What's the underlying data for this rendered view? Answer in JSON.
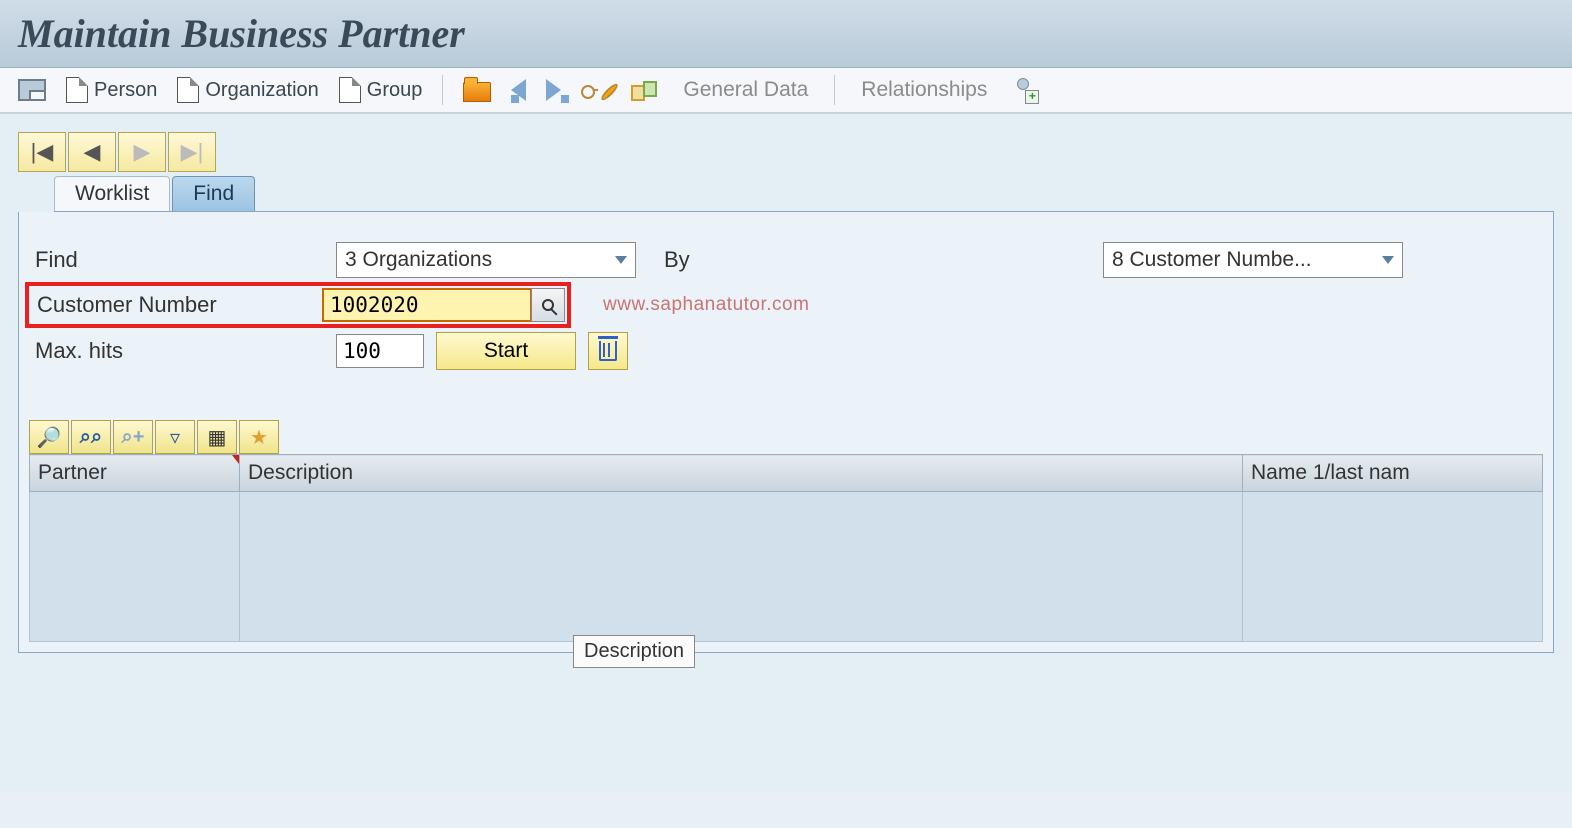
{
  "title": "Maintain Business Partner",
  "toolbar": {
    "person": "Person",
    "organization": "Organization",
    "group": "Group",
    "general_data": "General Data",
    "relationships": "Relationships"
  },
  "tabs": {
    "worklist": "Worklist",
    "find": "Find"
  },
  "find_form": {
    "find_label": "Find",
    "find_value": "3 Organizations",
    "by_label": "By",
    "by_value": "8 Customer Numbe...",
    "customer_number_label": "Customer Number",
    "customer_number_value": "1002020",
    "max_hits_label": "Max. hits",
    "max_hits_value": "100",
    "start_label": "Start",
    "watermark": "www.saphanatutor.com"
  },
  "table": {
    "columns": {
      "partner": "Partner",
      "description": "Description",
      "name1": "Name 1/last nam"
    }
  },
  "tooltip": "Description"
}
